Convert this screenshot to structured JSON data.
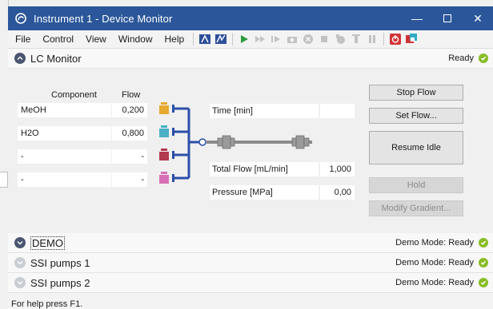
{
  "window": {
    "title": "Instrument 1 - Device Monitor"
  },
  "menu": [
    "File",
    "Control",
    "View",
    "Window",
    "Help"
  ],
  "lc_monitor": {
    "title": "LC Monitor",
    "status": "Ready",
    "headers": {
      "component": "Component",
      "flow": "Flow"
    },
    "rows": [
      {
        "component": "MeOH",
        "flow": "0,200",
        "bottle_color": "#e6a92f"
      },
      {
        "component": "H2O",
        "flow": "0,800",
        "bottle_color": "#4bb0c4"
      },
      {
        "component": "-",
        "flow": "-",
        "bottle_color": "#b23a4e"
      },
      {
        "component": "-",
        "flow": "-",
        "bottle_color": "#d86fb6"
      }
    ],
    "info": {
      "time_label": "Time [min]",
      "time_value": "",
      "total_flow_label": "Total Flow [mL/min]",
      "total_flow_value": "1,000",
      "pressure_label": "Pressure [MPa]",
      "pressure_value": "0,00"
    },
    "buttons": {
      "stop_flow": "Stop Flow",
      "set_flow": "Set Flow...",
      "resume_idle": "Resume Idle",
      "hold": "Hold",
      "modify_gradient": "Modify Gradient..."
    }
  },
  "panels": [
    {
      "title": "DEMO",
      "status": "Demo Mode: Ready"
    },
    {
      "title": "SSI pumps 1",
      "status": "Demo Mode: Ready"
    },
    {
      "title": "SSI pumps 2",
      "status": "Demo Mode: Ready"
    }
  ],
  "statusbar": {
    "text": "For help press F1."
  },
  "colors": {
    "titlebar": "#2b579a",
    "flow_line": "#2b4fa8",
    "ready_check": "#88bd26"
  }
}
